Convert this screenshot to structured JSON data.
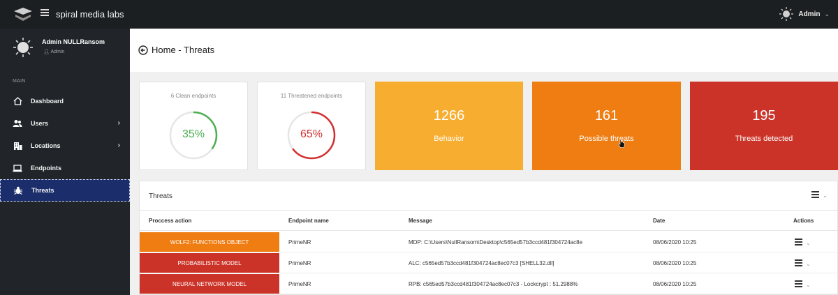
{
  "app": {
    "brand": "spiral media labs",
    "user_menu": "Admin"
  },
  "sidebar": {
    "profile_name": "Admin NULLRansom",
    "profile_role": "Admin",
    "section_label": "MAIN",
    "items": [
      {
        "label": "Dashboard",
        "icon": "home-icon"
      },
      {
        "label": "Users",
        "icon": "users-icon",
        "has_children": true
      },
      {
        "label": "Locations",
        "icon": "building-icon",
        "has_children": true
      },
      {
        "label": "Endpoints",
        "icon": "laptop-icon"
      },
      {
        "label": "Threats",
        "icon": "bug-icon",
        "active": true
      }
    ]
  },
  "header": {
    "home": "Home",
    "separator": " - ",
    "page": "Threats"
  },
  "stats": {
    "clean": {
      "title": "6 Clean endpoints",
      "percent_label": "35%",
      "percent": 35,
      "color": "#4caf50"
    },
    "threatened": {
      "title": "11 Threatened endpoints",
      "percent_label": "65%",
      "percent": 65,
      "color": "#d32f2f"
    },
    "tiles": [
      {
        "value": "1266",
        "label": "Behavior",
        "color": "#f7ad2f"
      },
      {
        "value": "161",
        "label": "Possible threats",
        "color": "#ef7d12"
      },
      {
        "value": "195",
        "label": "Threats detected",
        "color": "#cc3328"
      }
    ]
  },
  "threats_table": {
    "title": "Threats",
    "columns": [
      "Proccess action",
      "Endpoint name",
      "Message",
      "Date",
      "Actions"
    ],
    "rows": [
      {
        "action": "WOLF2: FUNCTIONS OBJECT",
        "color": "#ef7d12",
        "endpoint": "PrimeNR",
        "message": "MDP: C:\\Users\\NullRansom\\Desktop\\c565ed57b3ccd481f304724ac8e",
        "date": "08/06/2020 10:25"
      },
      {
        "action": "PROBABILISTIC MODEL",
        "color": "#cc3328",
        "endpoint": "PrimeNR",
        "message": "ALC: c565ed57b3ccd481f304724ac8ec07c3 [SHELL32.dll]",
        "date": "08/06/2020 10:25"
      },
      {
        "action": "NEURAL NETWORK MODEL",
        "color": "#cc3328",
        "endpoint": "PrimeNR",
        "message": "RPB: c565ed57b3ccd481f304724ac8ec07c3 - Lockcrypt : 51.2988%",
        "date": "08/06/2020 10:25"
      }
    ]
  }
}
